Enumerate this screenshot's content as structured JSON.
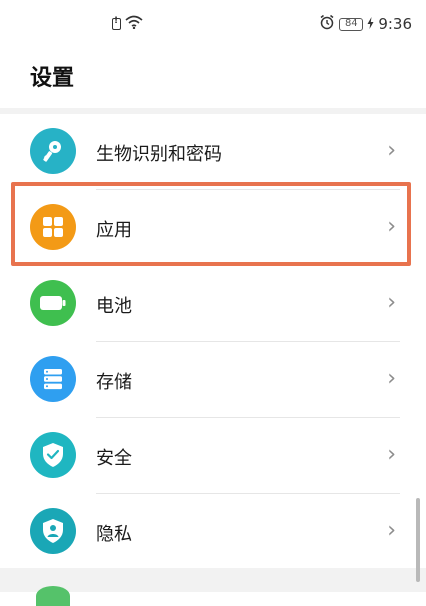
{
  "status_bar": {
    "time": "9:36",
    "battery_level": "84",
    "icons": [
      "sim-alert-icon",
      "wifi-icon",
      "alarm-icon",
      "battery-icon",
      "charging-icon"
    ]
  },
  "page": {
    "title": "设置"
  },
  "settings_items": [
    {
      "label": "生物识别和密码",
      "icon": "key-icon",
      "color": "#27b2c6"
    },
    {
      "label": "应用",
      "icon": "apps-grid-icon",
      "color": "#f39a16"
    },
    {
      "label": "电池",
      "icon": "battery-icon",
      "color": "#3fbf4f"
    },
    {
      "label": "存储",
      "icon": "storage-icon",
      "color": "#2f9ff0"
    },
    {
      "label": "安全",
      "icon": "shield-check-icon",
      "color": "#1fb6c1"
    },
    {
      "label": "隐私",
      "icon": "privacy-shield-icon",
      "color": "#1aa7b6"
    }
  ],
  "highlight": {
    "target": "应用",
    "color": "#e8734e"
  }
}
